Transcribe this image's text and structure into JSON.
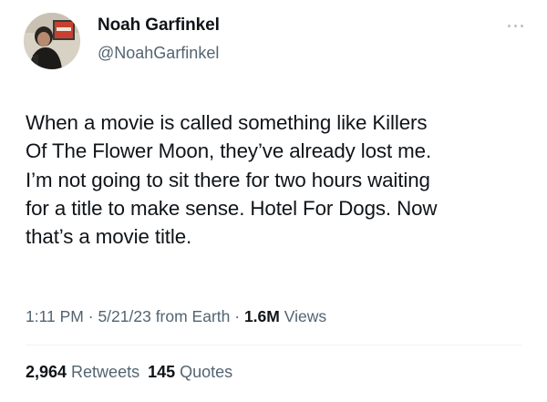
{
  "author": {
    "name": "Noah Garfinkel",
    "handle": "@NoahGarfinkel"
  },
  "tweet": {
    "lines": [
      "When a movie is called something like Killers",
      "Of The Flower Moon, they’ve already lost me.",
      "I’m not going to sit there for two hours waiting",
      "for a title to make sense. Hotel For Dogs. Now",
      "that’s a movie title."
    ]
  },
  "meta": {
    "time": "1:11 PM",
    "sep1": " · ",
    "date": "5/21/23",
    "source": " from Earth",
    "sep2": " · ",
    "views_count": "1.6M",
    "views_label": " Views"
  },
  "stats": {
    "retweets_count": "2,964",
    "retweets_label": " Retweets",
    "quotes_count": "145",
    "quotes_label": " Quotes"
  },
  "icons": {
    "more": "more-options-icon"
  },
  "colors": {
    "text": "#0f1419",
    "secondary": "#536471",
    "divider": "#eff3f4"
  }
}
